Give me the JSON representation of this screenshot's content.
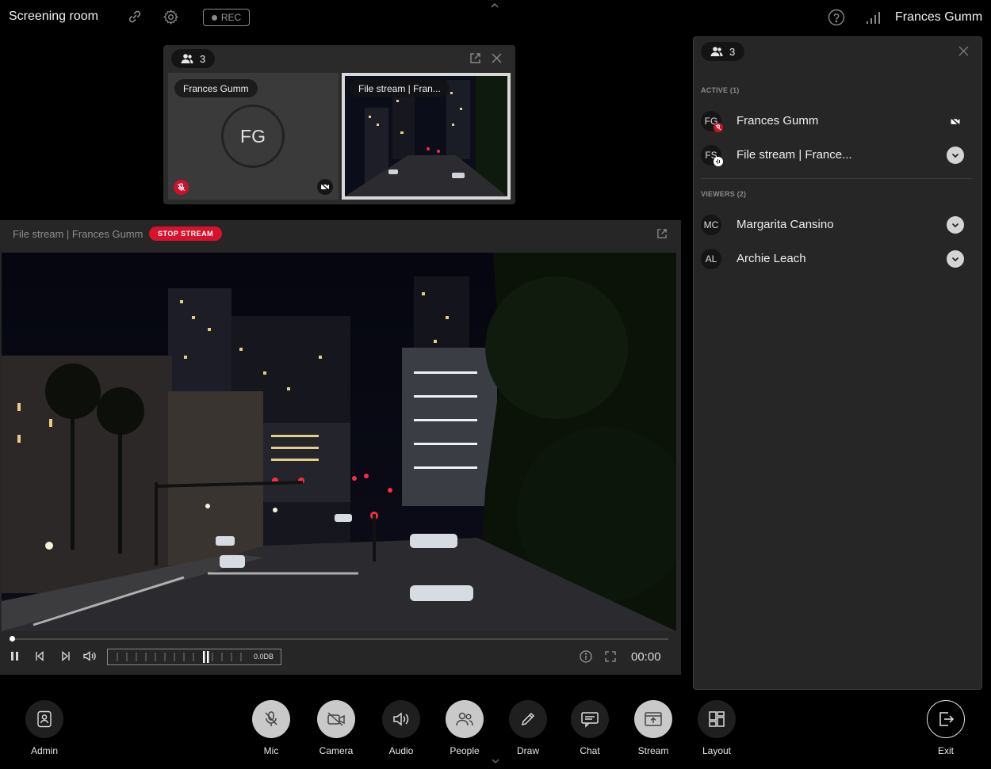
{
  "topbar": {
    "room_title": "Screening room",
    "rec_label": "REC",
    "user_name": "Frances Gumm",
    "icons": [
      "link-icon",
      "gear-icon",
      "help-icon",
      "signal-icon"
    ]
  },
  "tiles": {
    "participant_count": "3",
    "items": [
      {
        "name": "Frances Gumm",
        "initials": "FG",
        "mic": "muted",
        "camera": "off"
      },
      {
        "name": "File stream | Fran..."
      }
    ]
  },
  "stream": {
    "title": "File stream | Frances Gumm",
    "stop_label": "STOP STREAM",
    "progress_fraction": 0.0,
    "meter_value": "0.0DB",
    "time": "00:00"
  },
  "people": {
    "count": "3",
    "active_label": "ACTIVE (1)",
    "viewers_label": "VIEWERS (2)",
    "active": [
      {
        "initials": "FG",
        "name": "Frances Gumm"
      },
      {
        "initials": "FS",
        "name": "File stream | France..."
      }
    ],
    "viewers": [
      {
        "initials": "MC",
        "name": "Margarita Cansino"
      },
      {
        "initials": "AL",
        "name": "Archie Leach"
      }
    ]
  },
  "toolbar": {
    "admin": "Admin",
    "mic": "Mic",
    "camera": "Camera",
    "audio": "Audio",
    "people": "People",
    "draw": "Draw",
    "chat": "Chat",
    "stream": "Stream",
    "layout": "Layout",
    "exit": "Exit"
  },
  "colors": {
    "accent_red": "#d8122c",
    "panel_bg": "#262626",
    "page_bg": "#000000"
  }
}
